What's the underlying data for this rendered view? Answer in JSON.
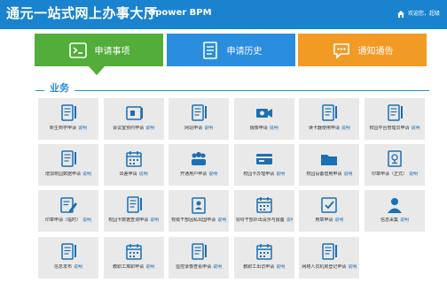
{
  "header": {
    "title": "通元一站式网上办事大厅",
    "subtitle": "Gpower BPM",
    "user_text": "欢迎您，超级"
  },
  "tabs": [
    {
      "label": "申请事项",
      "icon": "terminal-icon",
      "color": "#52ad3a"
    },
    {
      "label": "申请历史",
      "icon": "document-icon",
      "color": "#2a8ddd"
    },
    {
      "label": "通知通告",
      "icon": "chat-icon",
      "color": "#f29a26"
    }
  ],
  "section": {
    "title": "业务"
  },
  "services": [
    {
      "label": "新生到学申请",
      "note": "说明",
      "icon": "document-icon"
    },
    {
      "label": "会议室预约申请",
      "note": "说明",
      "icon": "id-card-icon"
    },
    {
      "label": "网站申请",
      "note": "说明",
      "icon": "document-icon"
    },
    {
      "label": "摄像申请",
      "note": "说明",
      "icon": "camera-icon"
    },
    {
      "label": "读卡器使用申请",
      "note": "说明",
      "icon": "document-icon"
    },
    {
      "label": "校园平台管理员申请",
      "note": "说明",
      "icon": "document-icon"
    },
    {
      "label": "增加校园数据申请",
      "note": "说明",
      "icon": "document-icon"
    },
    {
      "label": "出差申请",
      "note": "说明",
      "icon": "calendar-icon"
    },
    {
      "label": "开通用户申请",
      "note": "说明",
      "icon": "people-icon"
    },
    {
      "label": "校园卡办理申请",
      "note": "说明",
      "icon": "bank-card-icon"
    },
    {
      "label": "校园设备借用申请",
      "note": "说明",
      "icon": "folder-icon"
    },
    {
      "label": "印章申请（正式）",
      "note": "说明",
      "icon": "stamp-icon"
    },
    {
      "label": "印章申请（临时）",
      "note": "说明",
      "icon": "edit-document-icon"
    },
    {
      "label": "校园卡数据查询申请",
      "note": "说明",
      "icon": "document-icon"
    },
    {
      "label": "校级干部因私出国申请",
      "note": "说明",
      "icon": "user-card-icon"
    },
    {
      "label": "领导干部外出请示与报备",
      "note": "说明",
      "icon": "calendar-icon"
    },
    {
      "label": "用章申请",
      "note": "说明",
      "icon": "stamp-check-icon"
    },
    {
      "label": "信息采集",
      "note": "说明",
      "icon": "person-icon"
    },
    {
      "label": "信息发布",
      "note": "说明",
      "icon": "document-icon"
    },
    {
      "label": "教职工离职申请",
      "note": "说明",
      "icon": "calendar-icon"
    },
    {
      "label": "监控录像查看申请",
      "note": "说明",
      "icon": "document-icon"
    },
    {
      "label": "教职工出访申请",
      "note": "说明",
      "icon": "calendar-icon"
    },
    {
      "label": "网络人员机房登记申请",
      "note": "说明",
      "icon": "document-icon"
    }
  ],
  "colors": {
    "header": "#1a83cf",
    "icon_blue": "#1a6fb5",
    "tile_bg": "#e9e9e9"
  }
}
